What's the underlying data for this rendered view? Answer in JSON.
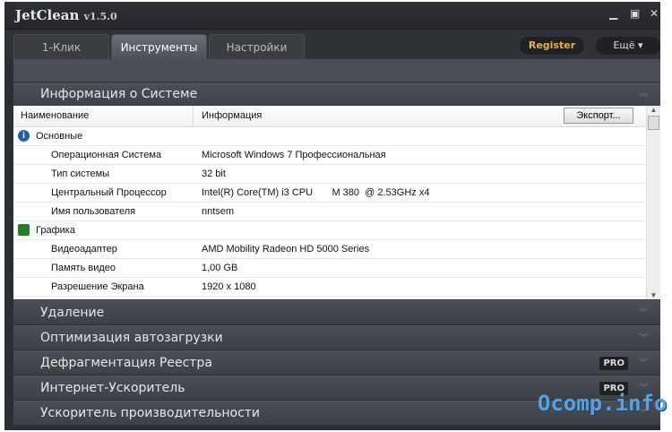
{
  "app": {
    "name": "JetClean",
    "version": "v1.5.0"
  },
  "tabs": [
    {
      "label": "1-Клик"
    },
    {
      "label": "Инструменты"
    },
    {
      "label": "Настройки"
    }
  ],
  "header": {
    "register": "Register",
    "more": "Ещё"
  },
  "section": {
    "title": "Информация о Системе",
    "col1": "Наименование",
    "col2": "Информация",
    "export": "Экспорт..."
  },
  "groups": [
    {
      "name": "Основные",
      "rows": [
        [
          "Операционная Система",
          "Microsoft Windows 7 Профессиональная"
        ],
        [
          "Тип системы",
          "32 bit"
        ],
        [
          "Центральный Процессор",
          "Intel(R) Core(TM) i3 CPU       M 380  @ 2.53GHz x4"
        ],
        [
          "Имя пользователя",
          "nntsem"
        ]
      ]
    },
    {
      "name": "Графика",
      "rows": [
        [
          "Видеоадаптер",
          "AMD Mobility Radeon HD 5000 Series"
        ],
        [
          "Память видео",
          "1,00 GB"
        ],
        [
          "Разрешение Экрана",
          "1920 x 1080"
        ]
      ]
    }
  ],
  "sections": [
    {
      "label": "Удаление",
      "pro": ""
    },
    {
      "label": "Оптимизация автозагрузки",
      "pro": ""
    },
    {
      "label": "Дефрагментация Реестра",
      "pro": "PRO"
    },
    {
      "label": "Интернет-Ускоритель",
      "pro": "PRO"
    },
    {
      "label": "Ускоритель производительности",
      "pro": ""
    }
  ],
  "watermark": "Ocomp.info"
}
